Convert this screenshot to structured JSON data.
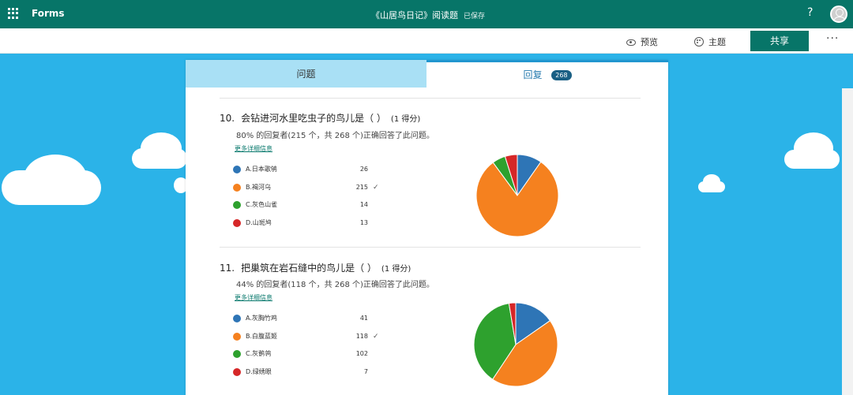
{
  "header": {
    "app_name": "Forms",
    "doc_title": "《山居鸟日记》阅读题",
    "saved_status": "已保存",
    "help_icon": "help-icon",
    "avatar_icon": "user-avatar-icon"
  },
  "toolbar": {
    "preview_label": "预览",
    "preview_icon": "eye-icon",
    "theme_label": "主题",
    "theme_icon": "palette-icon",
    "share_label": "共享",
    "more_label": "···"
  },
  "tabs": {
    "questions_label": "问题",
    "responses_label": "回复",
    "responses_count": "268"
  },
  "colors": {
    "brand": "#077568",
    "background": "#2bb3e8",
    "option_colors": [
      "#2e75b6",
      "#f5811f",
      "#2ea12e",
      "#d62728"
    ]
  },
  "questions": [
    {
      "number": "10.",
      "title": "会钻进河水里吃虫子的鸟儿是（ ）",
      "points": "(1 得分)",
      "stat": "80% 的回复者(215 个，共 268 个)正确回答了此问题。",
      "more_link": "更多详细信息",
      "options": [
        {
          "label": "A.日本歌鸲",
          "count": "26",
          "correct": false
        },
        {
          "label": "B.褐河乌",
          "count": "215",
          "correct": true
        },
        {
          "label": "C.灰色山雀",
          "count": "14",
          "correct": false
        },
        {
          "label": "D.山斑鸠",
          "count": "13",
          "correct": false
        }
      ]
    },
    {
      "number": "11.",
      "title": "把巢筑在岩石缝中的鸟儿是（ ）",
      "points": "(1 得分)",
      "stat": "44% 的回复者(118 个，共 268 个)正确回答了此问题。",
      "more_link": "更多详细信息",
      "options": [
        {
          "label": "A.灰胸竹鸡",
          "count": "41",
          "correct": false
        },
        {
          "label": "B.白腹蓝姬",
          "count": "118",
          "correct": true
        },
        {
          "label": "C.灰鹡鸰",
          "count": "102",
          "correct": false
        },
        {
          "label": "D.绿绣眼",
          "count": "7",
          "correct": false
        }
      ]
    }
  ],
  "chart_data": [
    {
      "type": "pie",
      "categories": [
        "A.日本歌鸲",
        "B.褐河乌",
        "C.灰色山雀",
        "D.山斑鸠"
      ],
      "values": [
        26,
        215,
        14,
        13
      ],
      "colors": [
        "#2e75b6",
        "#f5811f",
        "#2ea12e",
        "#d62728"
      ],
      "start_angle_deg": 0,
      "direction": "clockwise"
    },
    {
      "type": "pie",
      "categories": [
        "A.灰胸竹鸡",
        "B.白腹蓝姬",
        "C.灰鹡鸰",
        "D.绿绣眼"
      ],
      "values": [
        41,
        118,
        102,
        7
      ],
      "colors": [
        "#2e75b6",
        "#f5811f",
        "#2ea12e",
        "#d62728"
      ],
      "start_angle_deg": 0,
      "direction": "clockwise"
    }
  ]
}
